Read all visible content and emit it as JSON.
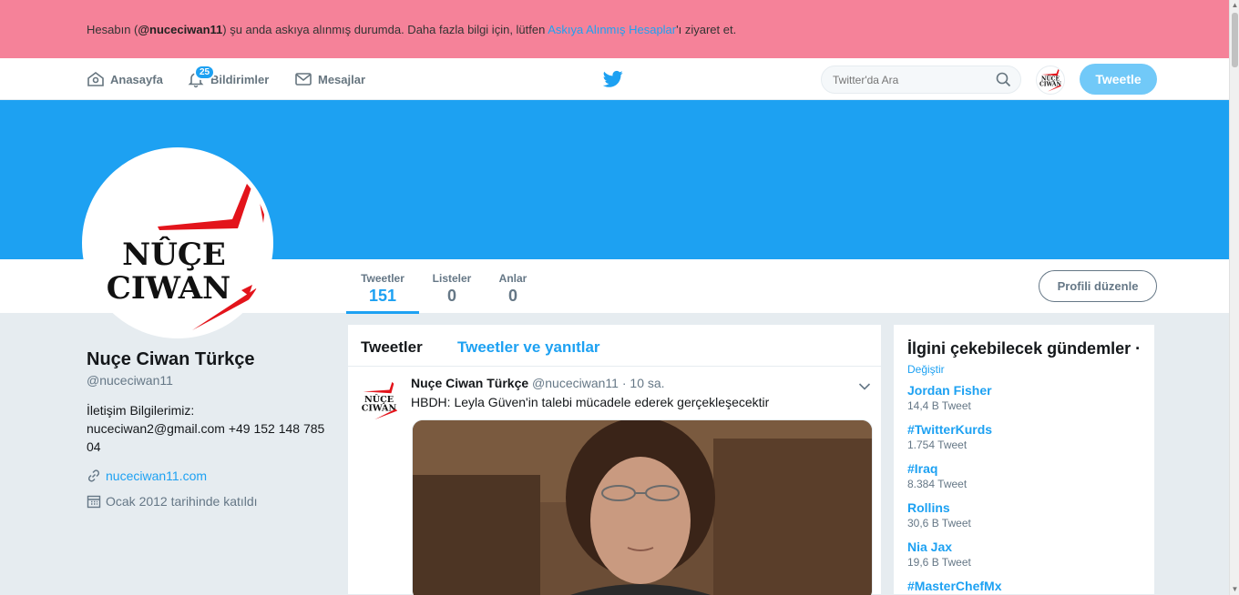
{
  "alert": {
    "prefix": "Hesabın (",
    "handle": "@nuceciwan11",
    "middle": ") şu anda askıya alınmış durumda. Daha fazla bilgi için, lütfen ",
    "link": "Askıya Alınmış Hesaplar",
    "suffix": "'ı ziyaret et."
  },
  "nav": {
    "home": "Anasayfa",
    "notifications": "Bildirimler",
    "notifications_badge": "25",
    "messages": "Mesajlar",
    "search_placeholder": "Twitter'da Ara",
    "tweet_button": "Tweetle"
  },
  "logo": {
    "line1": "NÛÇE",
    "line2": "CIWAN"
  },
  "profile": {
    "name": "Nuçe Ciwan Türkçe",
    "handle": "@nuceciwan11",
    "bio_line1": "İletişim Bilgilerimiz:",
    "bio_line2": "nuceciwan2@gmail.com +49 152 148 785 04",
    "url": "nuceciwan11.com",
    "joined": "Ocak 2012 tarihinde katıldı",
    "edit_button": "Profili düzenle"
  },
  "stats": {
    "tweets_label": "Tweetler",
    "tweets_value": "151",
    "lists_label": "Listeler",
    "lists_value": "0",
    "moments_label": "Anlar",
    "moments_value": "0"
  },
  "timeline": {
    "tab_tweets": "Tweetler",
    "tab_replies": "Tweetler ve yanıtlar",
    "tweet": {
      "name": "Nuçe Ciwan Türkçe",
      "handle": "@nuceciwan11",
      "sep": " · ",
      "time": "10 sa.",
      "text": "HBDH: Leyla Güven'in talebi mücadele ederek gerçekleşecektir"
    }
  },
  "trends": {
    "title": "İlgini çekebilecek gündemler",
    "dot": " ·",
    "change": "Değiştir",
    "items": [
      {
        "name": "Jordan Fisher",
        "count": "14,4 B Tweet"
      },
      {
        "name": "#TwitterKurds",
        "count": "1.754 Tweet"
      },
      {
        "name": "#Iraq",
        "count": "8.384 Tweet"
      },
      {
        "name": "Rollins",
        "count": "30,6 B Tweet"
      },
      {
        "name": "Nia Jax",
        "count": "19,6 B Tweet"
      },
      {
        "name": "#MasterChefMx",
        "count": ""
      }
    ]
  },
  "colors": {
    "brand": "#1da1f2",
    "alert_bg": "#f58299",
    "logo_red": "#e3141b"
  },
  "icons": [
    "home-icon",
    "bell-icon",
    "envelope-icon",
    "twitter-bird-icon",
    "search-icon",
    "link-icon",
    "calendar-icon",
    "chevron-down-icon"
  ]
}
